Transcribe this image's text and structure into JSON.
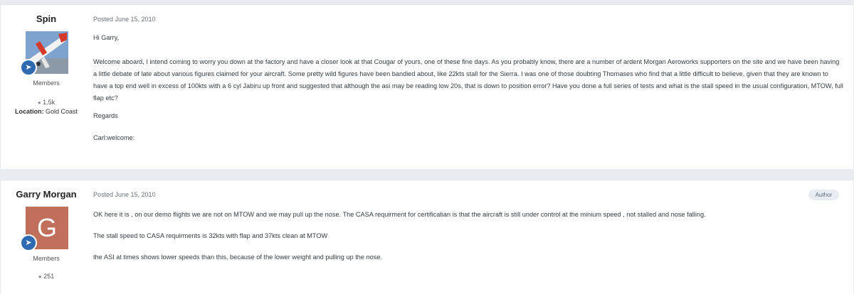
{
  "posts": [
    {
      "author": "Spin",
      "group": "Members",
      "post_count": "1.5k",
      "location_label": "Location:",
      "location_value": "Gold Coast",
      "date": "Posted June 15, 2010",
      "paragraphs": [
        "Hi Garry,",
        "Welcome aboard, I intend coming to worry you down at the factory and have a closer look at that Cougar of yours, one of these fine days. As you probably know, there are a number of ardent Morgan Aeroworks supporters on the site and we have been having a little debate of late about various figures claimed for your aircraft. Some pretty wild figures have been bandied about, like 22kts stall for the Sierra. I was one of those doubting Thomases who find that a little difficult to believe, given that they are known to have a top end well in excess of 100kts with a 6 cyl Jabiru up front and suggested that although the asi may be reading low 20s, that is down to position error? Have you done a full series of tests and what is the stall speed in the usual configuration, MTOW, full flap etc?",
        "Regards",
        "Carl:welcome:"
      ]
    },
    {
      "author": "Garry Morgan",
      "group": "Members",
      "post_count": "251",
      "avatar_letter": "G",
      "date": "Posted June 15, 2010",
      "author_badge": "Author",
      "paragraphs": [
        "OK here it is , on our demo flights we are not on MTOW and we may pull up the nose. The CASA requirment for certificatian is that the aircraft is still under control at the minium speed , not stalled and nose falling.",
        "The stall speed to CASA requirments is 32kts with flap and 37kts clean at MTOW",
        "the ASI at times shows lower speeds than this, because of the lower weight and pulling up the nose."
      ]
    }
  ],
  "colors": {
    "badge": "#2f6bb3",
    "avatar_g": "#c0705a",
    "page_bg": "#e9ecf0"
  },
  "icons": {
    "rank_badge": "rocket-icon",
    "post_count": "speech-bubble-icon"
  }
}
